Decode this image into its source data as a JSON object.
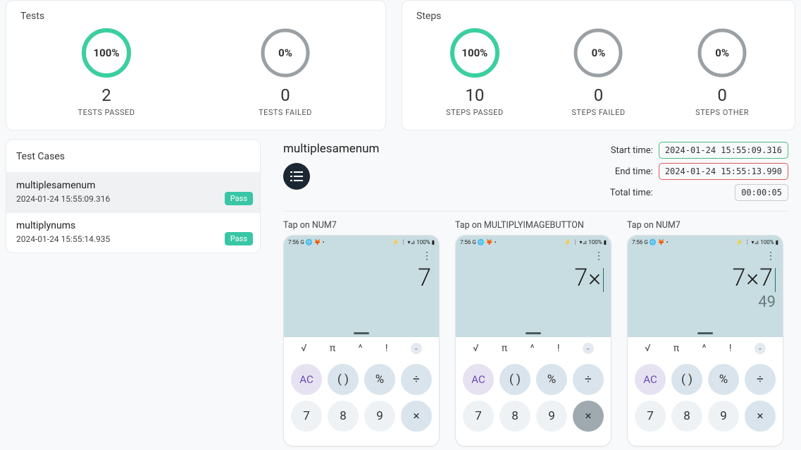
{
  "tests_card": {
    "title": "Tests",
    "passed": {
      "pct": "100%",
      "count": "2",
      "label": "TESTS PASSED"
    },
    "failed": {
      "pct": "0%",
      "count": "0",
      "label": "TESTS FAILED"
    }
  },
  "steps_card": {
    "title": "Steps",
    "passed": {
      "pct": "100%",
      "count": "10",
      "label": "STEPS PASSED"
    },
    "failed": {
      "pct": "0%",
      "count": "0",
      "label": "STEPS FAILED"
    },
    "other": {
      "pct": "0%",
      "count": "0",
      "label": "STEPS OTHER"
    }
  },
  "sidebar": {
    "title": "Test Cases",
    "items": [
      {
        "name": "multiplesamenum",
        "time": "2024-01-24 15:55:09.316",
        "status": "Pass",
        "selected": true
      },
      {
        "name": "multiplynums",
        "time": "2024-01-24 15:55:14.935",
        "status": "Pass",
        "selected": false
      }
    ]
  },
  "detail": {
    "title": "multiplesamenum",
    "start_label": "Start time:",
    "start_value": "2024-01-24 15:55:09.316",
    "end_label": "End time:",
    "end_value": "2024-01-24 15:55:13.990",
    "total_label": "Total time:",
    "total_value": "00:00:05"
  },
  "steps": [
    {
      "label": "Tap on NUM7",
      "expr": "7",
      "result": "",
      "cursor": false,
      "pressed_key": ""
    },
    {
      "label": "Tap on MULTIPLYIMAGEBUTTON",
      "expr": "7×",
      "result": "",
      "cursor": true,
      "pressed_key": "×"
    },
    {
      "label": "Tap on NUM7",
      "expr": "7×7",
      "result": "49",
      "cursor": true,
      "pressed_key": ""
    }
  ],
  "phone": {
    "status_left": "7:56 G 🌐 🦊 •",
    "status_right": "⚡ ⋮ ▾⊿ 100% ▮",
    "sym_row": [
      "√",
      "π",
      "^",
      "!"
    ],
    "row1": [
      "AC",
      "( )",
      "%",
      "÷"
    ],
    "row2": [
      "7",
      "8",
      "9",
      "×"
    ]
  }
}
